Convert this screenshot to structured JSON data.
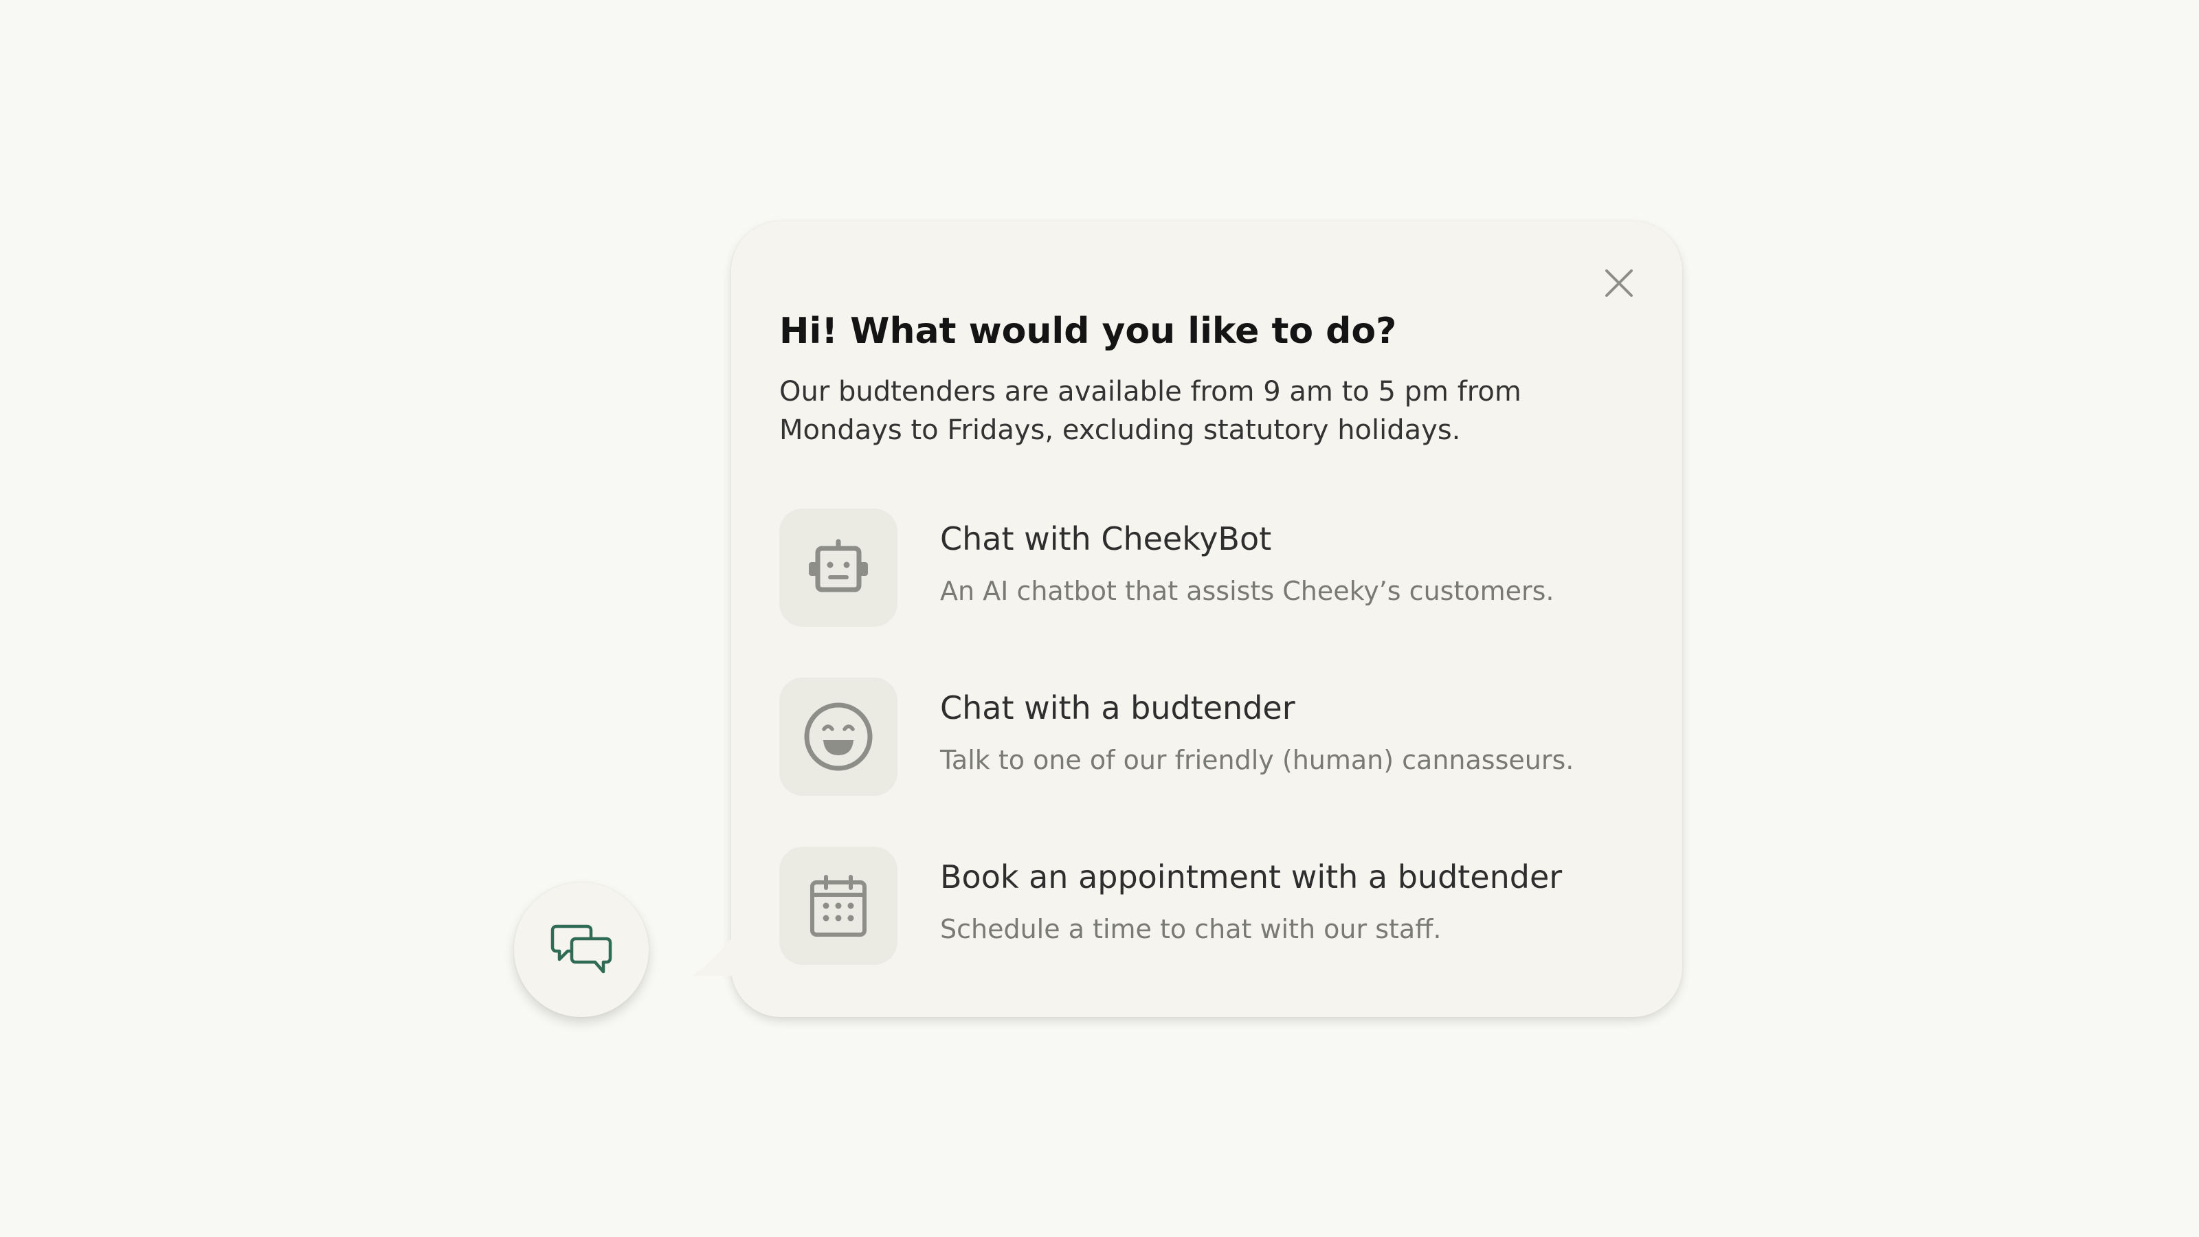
{
  "colors": {
    "page_background": "#f8f8f4",
    "panel_background": "#f5f4ef",
    "icon_tile": "#ebeae3",
    "icon_gray": "#8e8e88",
    "launcher_accent": "#2f6b55"
  },
  "popup": {
    "title": "Hi! What would you like to do?",
    "subtitle": "Our budtenders are available from 9 am to 5 pm from Mondays to Fridays, excluding statutory holidays.",
    "close_icon": "close-icon",
    "options": [
      {
        "icon": "robot-icon",
        "title": "Chat with CheekyBot",
        "description": "An AI chatbot that assists Cheeky’s customers."
      },
      {
        "icon": "smiley-face-icon",
        "title": "Chat with a budtender",
        "description": "Talk to one of our friendly (human) cannasseurs."
      },
      {
        "icon": "calendar-icon",
        "title": "Book an appointment with a budtender",
        "description": "Schedule a time to chat with our staff."
      }
    ]
  },
  "launcher": {
    "icon": "chat-bubbles-icon"
  }
}
